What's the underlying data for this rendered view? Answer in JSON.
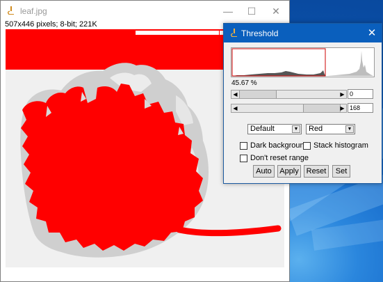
{
  "image_window": {
    "title": "leaf.jpg",
    "info": "507x446 pixels; 8-bit; 221K"
  },
  "threshold_window": {
    "title": "Threshold",
    "percent": "45.67 %",
    "sliders": [
      {
        "value": "0",
        "thumb_position": 0.0
      },
      {
        "value": "168",
        "thumb_position": 0.659
      }
    ],
    "method": "Default",
    "display": "Red",
    "checkboxes": {
      "dark_background": {
        "label": "Dark background",
        "checked": false
      },
      "stack_histogram": {
        "label": "Stack histogram",
        "checked": false
      },
      "dont_reset_range": {
        "label": "Don't reset range",
        "checked": false
      }
    },
    "buttons": {
      "auto": "Auto",
      "apply": "Apply",
      "reset": "Reset",
      "set": "Set"
    }
  },
  "colors": {
    "threshold_red": "#ff0000",
    "titlebar_active": "#0a5fbd",
    "selection_box": "#cc0000"
  },
  "icons": [
    "microscope-icon",
    "minimize-icon",
    "maximize-icon",
    "close-icon",
    "arrow-left-icon",
    "arrow-right-icon",
    "dropdown-arrow-icon"
  ]
}
